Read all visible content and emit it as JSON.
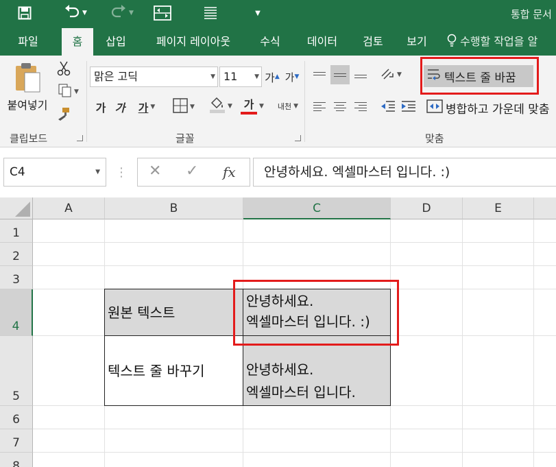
{
  "titlebar": {
    "doc_title": "통합 문서"
  },
  "tabs": [
    {
      "label": "파일",
      "active": false
    },
    {
      "label": "홈",
      "active": true
    },
    {
      "label": "삽입",
      "active": false
    },
    {
      "label": "페이지 레이아웃",
      "active": false
    },
    {
      "label": "수식",
      "active": false
    },
    {
      "label": "데이터",
      "active": false
    },
    {
      "label": "검토",
      "active": false
    },
    {
      "label": "보기",
      "active": false
    }
  ],
  "tellme": {
    "text": "수행할 작업을 알"
  },
  "ribbon": {
    "clipboard": {
      "paste_label": "붙여넣기",
      "group_label": "클립보드"
    },
    "font": {
      "font_name": "맑은 고딕",
      "font_size": "11",
      "grow_label": "가",
      "shrink_label": "가",
      "bold_label": "가",
      "italic_label": "가",
      "underline_label": "가",
      "font_color_label": "가",
      "phonetic_label": "내천",
      "group_label": "글꼴"
    },
    "alignment": {
      "wrap_text_label": "텍스트 줄 바꿈",
      "merge_center_label": "병합하고 가운데 맞춤",
      "group_label": "맞춤"
    }
  },
  "formula_bar": {
    "name_box": "C4",
    "formula": "안녕하세요. 엑셀마스터 입니다. :)"
  },
  "sheet": {
    "columns": [
      "A",
      "B",
      "C",
      "D",
      "E"
    ],
    "rows": [
      "1",
      "2",
      "3",
      "4",
      "5",
      "6",
      "7",
      "8"
    ],
    "selected_column": "C",
    "selected_row": "4",
    "cells": {
      "B4": "원본 텍스트",
      "C4": "안녕하세요. 엑셀마스터 입니다. :)",
      "B5": "텍스트 줄 바꾸기",
      "C5": "안녕하세요.\n엑셀마스터 입니다.\n:)"
    }
  },
  "colors": {
    "excel_green": "#217346",
    "highlight_red": "#e31b1b",
    "cell_fill": "#d9d9d9"
  }
}
